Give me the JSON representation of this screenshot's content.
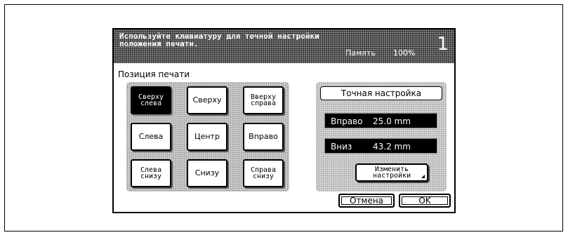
{
  "header": {
    "message": "Используйте клавиатуру для точной настройки\nположения печати.",
    "memory_label": "Память",
    "memory_value": "100%",
    "copies": "1"
  },
  "section": {
    "title": "Позиция печати"
  },
  "positions": [
    {
      "label": "Сверху\nслева",
      "selected": true
    },
    {
      "label": "Сверху",
      "selected": false
    },
    {
      "label": "Вверху\nсправа",
      "selected": false
    },
    {
      "label": "Слева",
      "selected": false
    },
    {
      "label": "Центр",
      "selected": false
    },
    {
      "label": "Вправо",
      "selected": false
    },
    {
      "label": "Слева\nснизу",
      "selected": false
    },
    {
      "label": "Снизу",
      "selected": false
    },
    {
      "label": "Справа\nснизу",
      "selected": false
    }
  ],
  "fine": {
    "title": "Точная настройка",
    "right_label": "Вправо",
    "right_value": "25.0 mm",
    "down_label": "Вниз",
    "down_value": "43.2 mm",
    "change_label": "Изменить\nнастройки"
  },
  "buttons": {
    "cancel": "Отмена",
    "ok": "OK"
  },
  "colors": {
    "selected_bg": "#000000",
    "header_bg": "#3a3a3a"
  }
}
